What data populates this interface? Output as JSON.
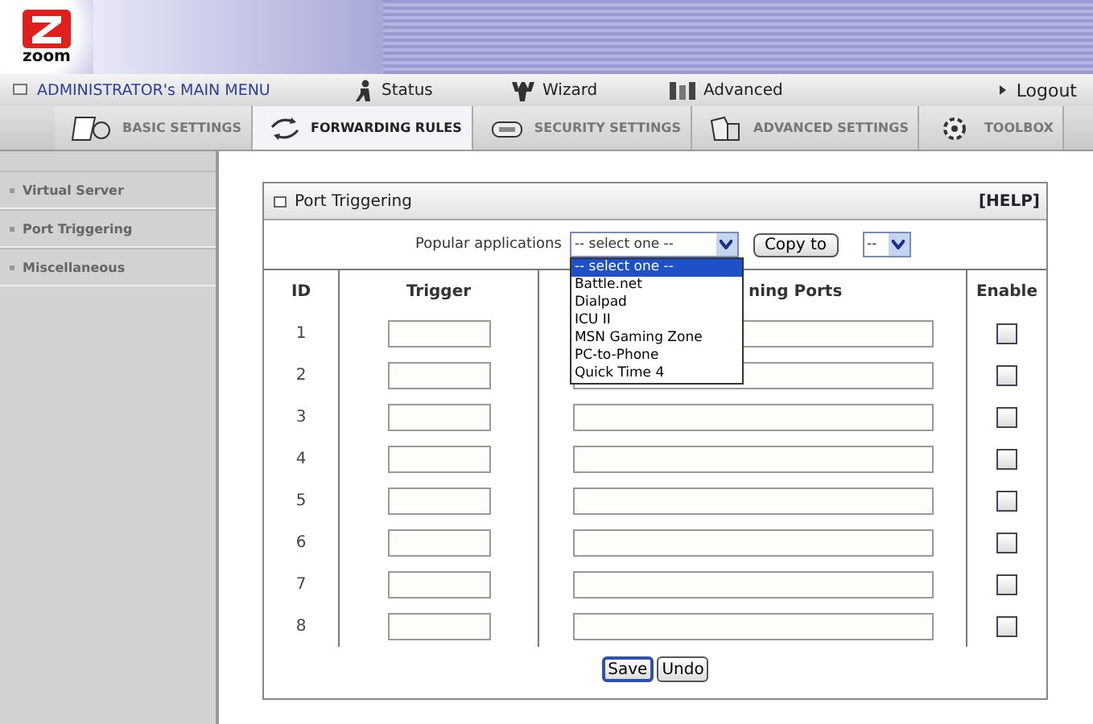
{
  "logo": {
    "text": "zoom"
  },
  "menu": {
    "title": "ADMINISTRATOR's MAIN MENU",
    "items": [
      {
        "label": "Status",
        "kind": "status"
      },
      {
        "label": "Wizard",
        "kind": "wizard"
      },
      {
        "label": "Advanced",
        "kind": "advanced"
      }
    ],
    "logout": "Logout"
  },
  "tabs": [
    {
      "label": "BASIC SETTINGS",
      "selected": false,
      "kind": "basic"
    },
    {
      "label": "FORWARDING RULES",
      "selected": true,
      "kind": "forwarding"
    },
    {
      "label": "SECURITY SETTINGS",
      "selected": false,
      "kind": "security"
    },
    {
      "label": "ADVANCED SETTINGS",
      "selected": false,
      "kind": "advanced"
    },
    {
      "label": "TOOLBOX",
      "selected": false,
      "kind": "toolbox"
    }
  ],
  "sidebar": {
    "items": [
      {
        "label": "Virtual Server"
      },
      {
        "label": "Port Triggering"
      },
      {
        "label": "Miscellaneous"
      }
    ]
  },
  "panel": {
    "title": "Port Triggering",
    "help": "[HELP]",
    "popular_label": "Popular applications",
    "select_value": "-- select one --",
    "copy_button": "Copy to",
    "target_value": "--",
    "dropdown": [
      {
        "label": "-- select one --",
        "selected": true
      },
      {
        "label": "Battle.net",
        "selected": false
      },
      {
        "label": "Dialpad",
        "selected": false
      },
      {
        "label": "ICU II",
        "selected": false
      },
      {
        "label": "MSN Gaming Zone",
        "selected": false
      },
      {
        "label": "PC-to-Phone",
        "selected": false
      },
      {
        "label": "Quick Time 4",
        "selected": false
      }
    ],
    "columns": [
      "ID",
      "Trigger",
      "ning Ports",
      "Enable"
    ],
    "rows": [
      {
        "id": "1",
        "enabled": false
      },
      {
        "id": "2",
        "enabled": false
      },
      {
        "id": "3",
        "enabled": false
      },
      {
        "id": "4",
        "enabled": false
      },
      {
        "id": "5",
        "enabled": false
      },
      {
        "id": "6",
        "enabled": false
      },
      {
        "id": "7",
        "enabled": false
      },
      {
        "id": "8",
        "enabled": false
      }
    ],
    "buttons": [
      {
        "label": "Save",
        "kind": "primary"
      },
      {
        "label": "Undo",
        "kind": "normal"
      }
    ]
  }
}
